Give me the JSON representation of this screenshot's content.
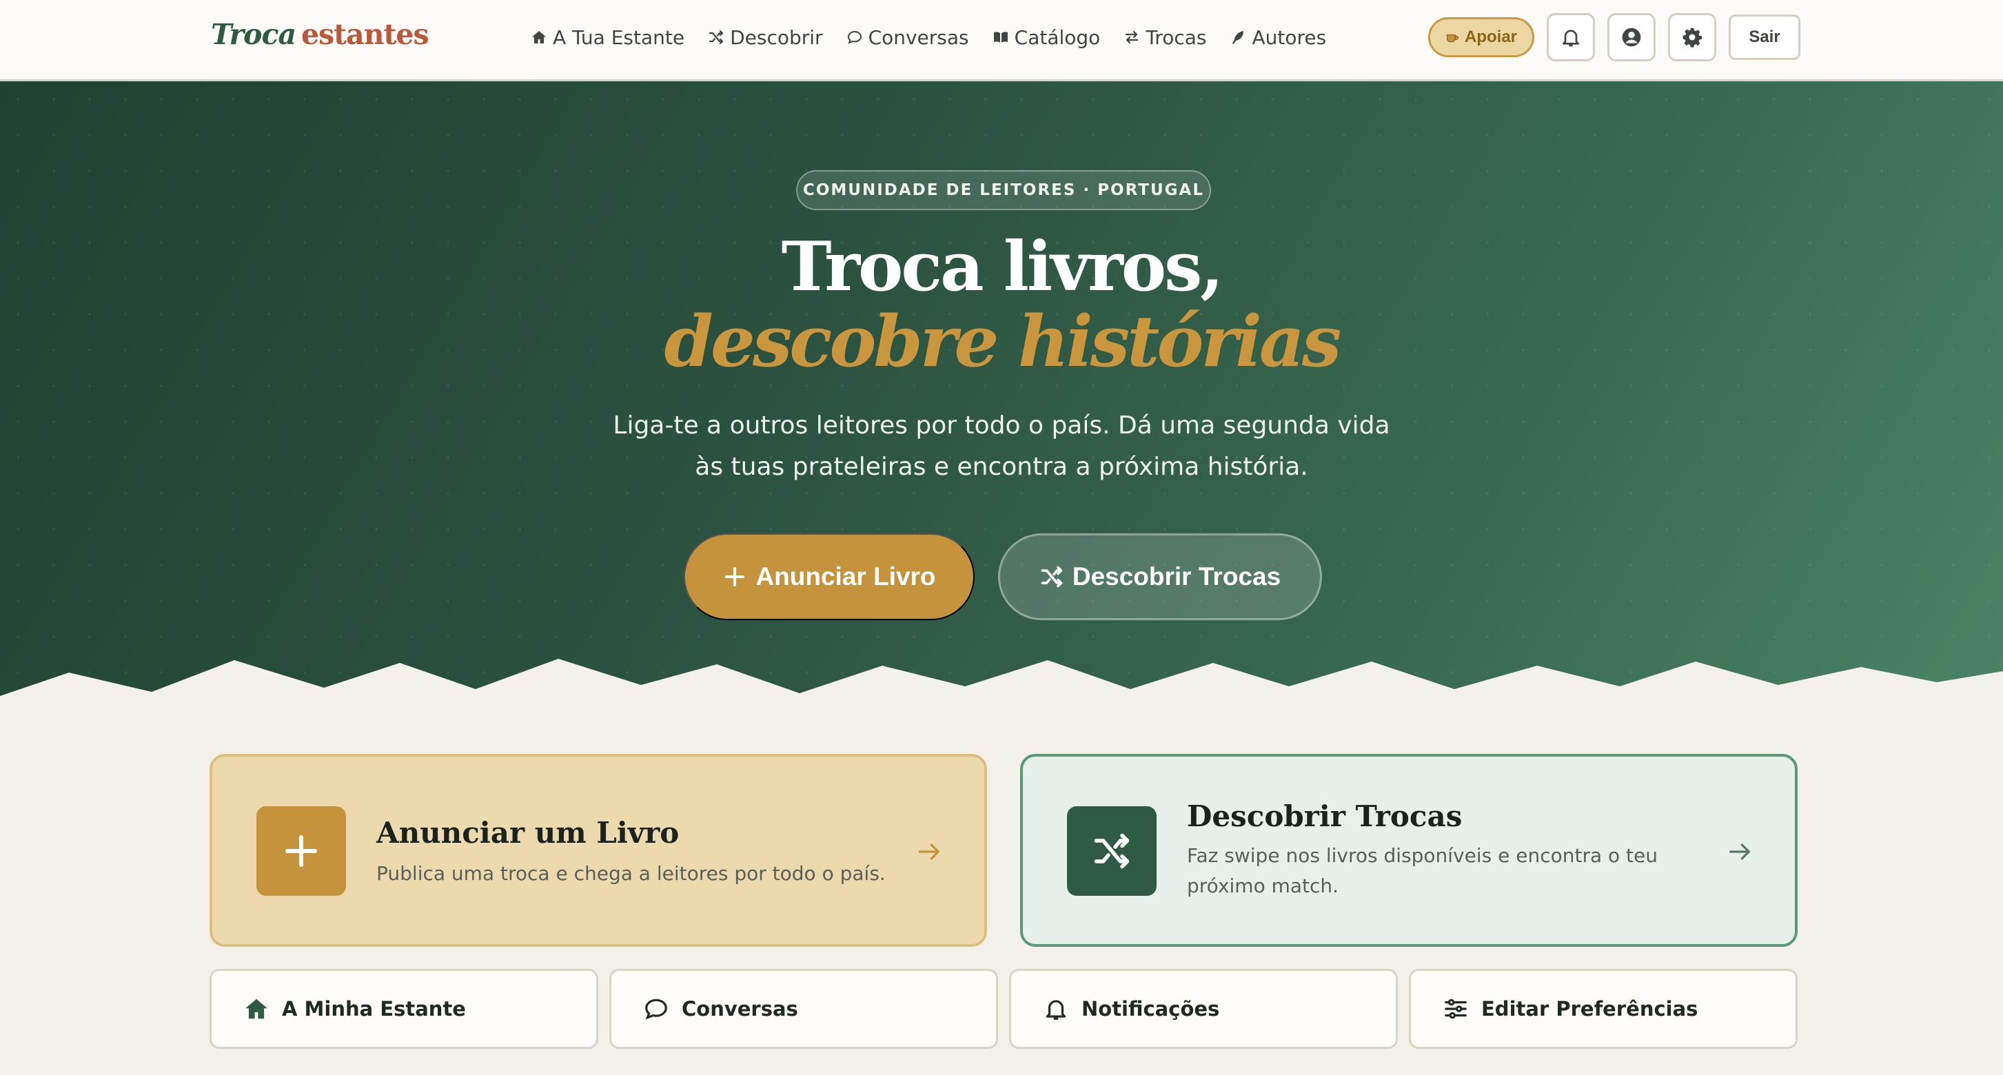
{
  "logo": {
    "part1": "Troca",
    "part2": "estantes"
  },
  "nav": {
    "links": [
      {
        "label": "A Tua Estante",
        "icon": "home-icon"
      },
      {
        "label": "Descobrir",
        "icon": "shuffle-icon"
      },
      {
        "label": "Conversas",
        "icon": "chat-icon"
      },
      {
        "label": "Catálogo",
        "icon": "book-open-icon"
      },
      {
        "label": "Trocas",
        "icon": "swap-arrows-icon"
      },
      {
        "label": "Autores",
        "icon": "feather-pen-icon"
      }
    ],
    "support_label": "Apoiar",
    "logout_label": "Sair"
  },
  "hero": {
    "badge": "COMUNIDADE DE LEITORES · PORTUGAL",
    "title_line1": "Troca livros,",
    "title_line2": "descobre histórias",
    "subtitle_line1": "Liga-te a outros leitores por todo o país. Dá uma segunda vida",
    "subtitle_line2": "às tuas prateleiras e encontra a próxima história.",
    "primary_cta": "Anunciar Livro",
    "secondary_cta": "Descobrir Trocas"
  },
  "cards": [
    {
      "title": "Anunciar um Livro",
      "description": "Publica uma troca e chega a leitores por todo o país.",
      "icon": "plus-icon"
    },
    {
      "title": "Descobrir Trocas",
      "description": "Faz swipe nos livros disponíveis e encontra o teu próximo match.",
      "icon": "shuffle-icon"
    }
  ],
  "quick_links": [
    {
      "label": "A Minha Estante",
      "icon": "home-icon"
    },
    {
      "label": "Conversas",
      "icon": "chat-icon"
    },
    {
      "label": "Notificações",
      "icon": "bell-icon"
    },
    {
      "label": "Editar Preferências",
      "icon": "sliders-icon"
    }
  ],
  "colors": {
    "brand_green": "#2f5a44",
    "accent_gold": "#c6933d",
    "logo_accent": "#b8593c",
    "page_bg": "#f3f1ea"
  }
}
